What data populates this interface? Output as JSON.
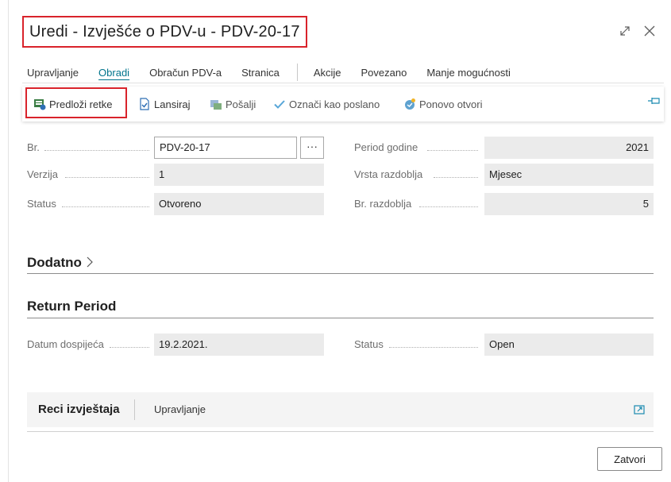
{
  "window": {
    "title": "Uredi - Izvješće o PDV-u - PDV-20-17"
  },
  "menu": {
    "items": [
      "Upravljanje",
      "Obradi",
      "Obračun PDV-a",
      "Stranica"
    ],
    "items2": [
      "Akcije",
      "Povezano",
      "Manje mogućnosti"
    ],
    "active": "Obradi"
  },
  "actions": {
    "submit_lines": "Predloži retke",
    "release": "Lansiraj",
    "send": "Pošalji",
    "mark_sent": "Označi kao poslano",
    "reopen": "Ponovo otvori"
  },
  "general": {
    "no_label": "Br.",
    "no_value": "PDV-20-17",
    "version_label": "Verzija",
    "version_value": "1",
    "status_label": "Status",
    "status_value": "Otvoreno",
    "period_year_label": "Period godine",
    "period_year_value": "2021",
    "period_type_label": "Vrsta razdoblja",
    "period_type_value": "Mjesec",
    "period_no_label": "Br. razdoblja",
    "period_no_value": "5",
    "more_glyph": "···"
  },
  "sections": {
    "additional": "Dodatno",
    "return_period": "Return Period"
  },
  "return_period": {
    "due_date_label": "Datum dospijeća",
    "due_date_value": "19.2.2021.",
    "status_label": "Status",
    "status_value": "Open"
  },
  "lines_part": {
    "title": "Reci izvještaja",
    "menu": "Upravljanje"
  },
  "footer": {
    "close": "Zatvori"
  },
  "icons": {
    "expand": "expand-icon",
    "close": "close-icon",
    "pin": "pin-icon"
  },
  "colors": {
    "accent": "#00748c",
    "highlight": "#d9232b",
    "readonly_bg": "#ebebeb"
  }
}
